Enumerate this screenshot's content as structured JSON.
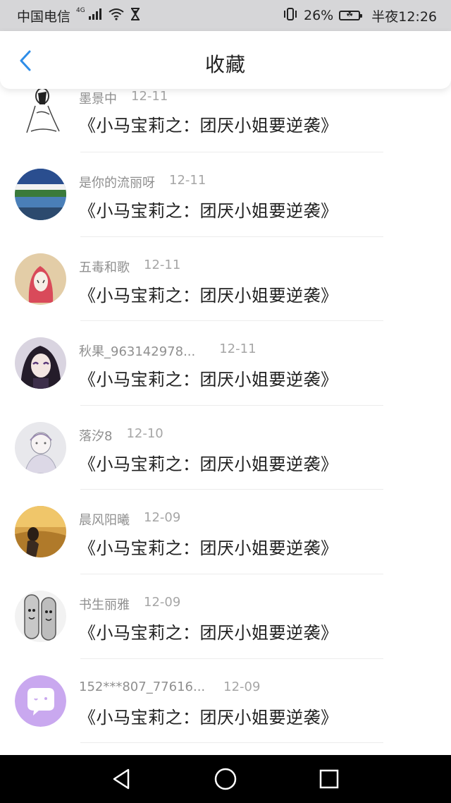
{
  "status_bar": {
    "carrier": "中国电信",
    "network": "4G",
    "battery_percent": "26%",
    "time": "半夜12:26"
  },
  "header": {
    "title": "收藏",
    "accent_color": "#2e8de8"
  },
  "items": [
    {
      "username": "墨景中",
      "date": "12-11",
      "book": "《小马宝莉之：团厌小姐要逆袭》",
      "avatar": "sketch-figure"
    },
    {
      "username": "是你的流丽呀",
      "date": "12-11",
      "book": "《小马宝莉之：团厌小姐要逆袭》",
      "avatar": "lake-landscape"
    },
    {
      "username": "五毒和歌",
      "date": "12-11",
      "book": "《小马宝莉之：团厌小姐要逆袭》",
      "avatar": "pink-hair-girl"
    },
    {
      "username": "秋果_963142978...",
      "date": "12-11",
      "book": "《小马宝莉之：团厌小姐要逆袭》",
      "avatar": "anime-girl"
    },
    {
      "username": "落汐8",
      "date": "12-10",
      "book": "《小马宝莉之：团厌小姐要逆袭》",
      "avatar": "sketch-girl"
    },
    {
      "username": "晨风阳曦",
      "date": "12-09",
      "book": "《小马宝莉之：团厌小姐要逆袭》",
      "avatar": "sunset-field"
    },
    {
      "username": "书生丽雅",
      "date": "12-09",
      "book": "《小马宝莉之：团厌小姐要逆袭》",
      "avatar": "finger-faces"
    },
    {
      "username": "152***807_77616...",
      "date": "12-09",
      "book": "《小马宝莉之：团厌小姐要逆袭》",
      "avatar": "chat-bubble"
    }
  ]
}
